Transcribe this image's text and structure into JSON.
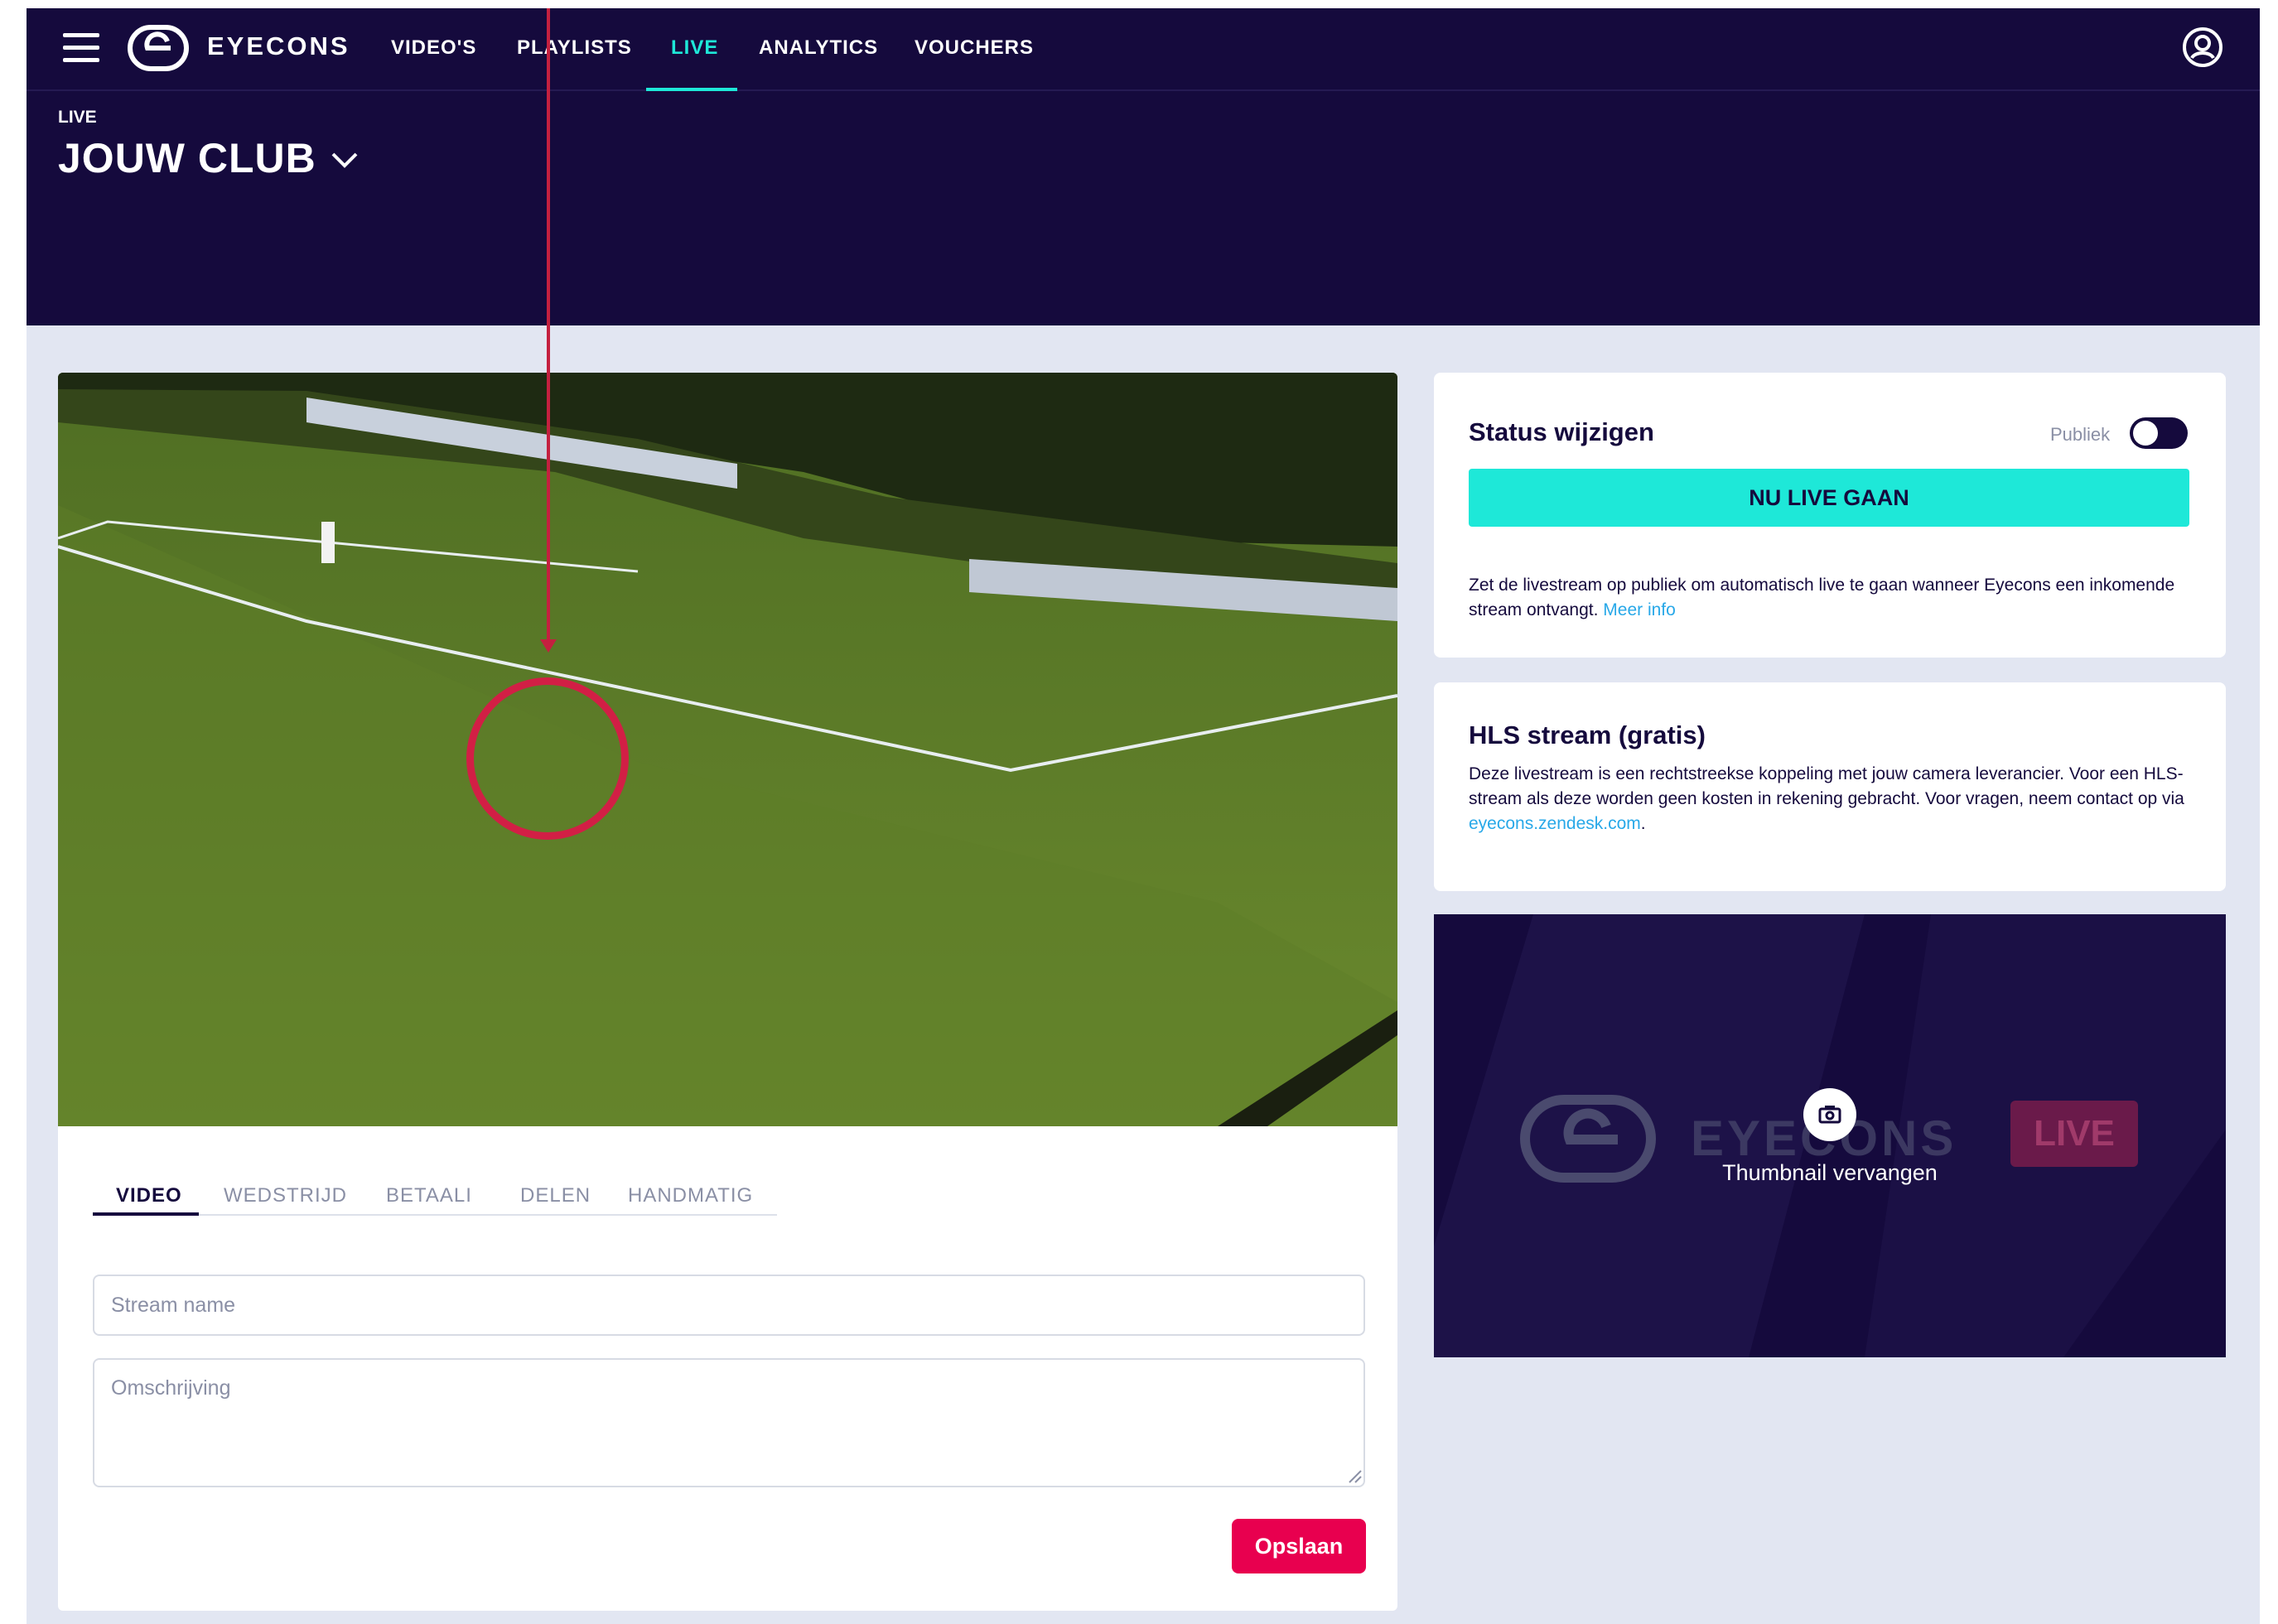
{
  "nav": {
    "brand": "EYECONS",
    "items": [
      {
        "label": "VIDEO'S"
      },
      {
        "label": "PLAYLISTS"
      },
      {
        "label": "LIVE"
      },
      {
        "label": "ANALYTICS"
      },
      {
        "label": "VOUCHERS"
      }
    ],
    "active_item": "LIVE",
    "icons": [
      "hamburger-menu-icon",
      "eyecons-logo-icon",
      "user-account-icon"
    ]
  },
  "header": {
    "breadcrumb": "LIVE",
    "club": "JOUW CLUB"
  },
  "video": {
    "tabs": [
      {
        "label": "VIDEO"
      },
      {
        "label": "WEDSTRIJD"
      },
      {
        "label": "BETAALI"
      },
      {
        "label": "DELEN"
      },
      {
        "label": "HANDMATIG"
      }
    ],
    "active_tab": "VIDEO",
    "stream_name_placeholder": "Stream name",
    "description_placeholder": "Omschrijving",
    "save_label": "Opslaan"
  },
  "status": {
    "title": "Status wijzigen",
    "public_label": "Publiek",
    "public_enabled": false,
    "go_live_label": "NU LIVE GAAN",
    "help_text": "Zet de livestream op publiek om automatisch live te gaan wanneer Eyecons een inkomende stream ontvangt.",
    "more_info_link": "Meer info"
  },
  "hls": {
    "title": "HLS stream (gratis)",
    "text": "Deze livestream is een rechtstreekse koppeling met jouw camera leverancier. Voor een HLS-stream als deze worden geen kosten in rekening gebracht. Voor vragen, neem contact op via",
    "link": "eyecons.zendesk.com",
    "suffix": "."
  },
  "thumbnail": {
    "label": "Thumbnail vervangen",
    "watermark_brand": "EYECONS",
    "watermark_badge": "LIVE"
  },
  "colors": {
    "navy": "#150a3d",
    "accent": "#1ee8d8",
    "save": "#e8004f",
    "link": "#28a8e8",
    "annotation": "#d21f45"
  }
}
